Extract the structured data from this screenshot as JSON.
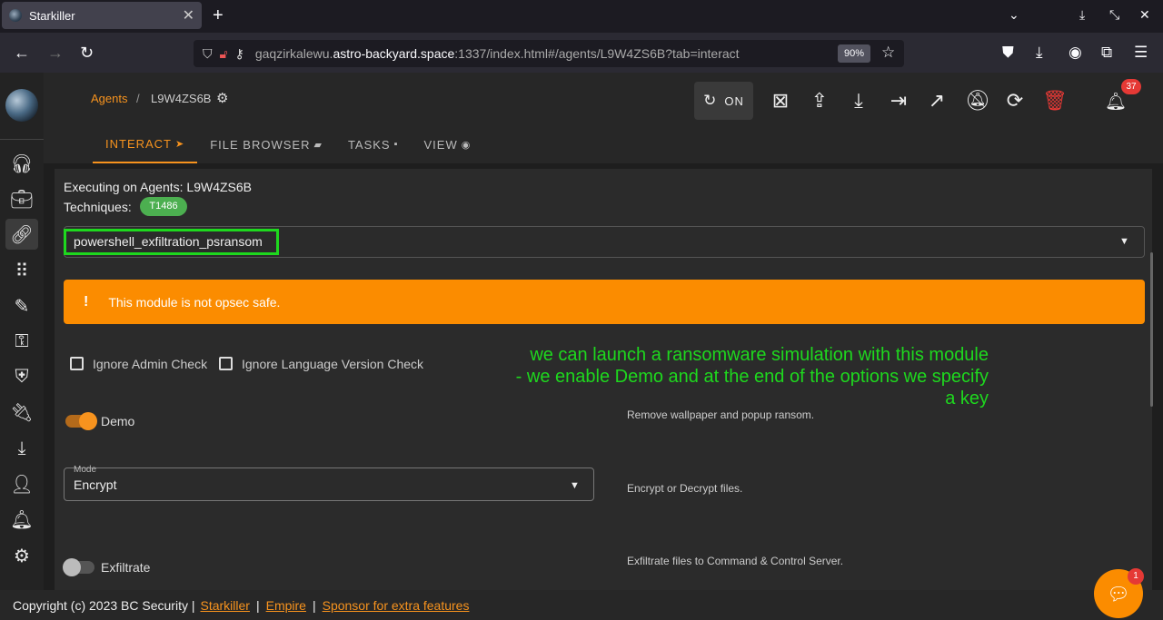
{
  "browser": {
    "tab_title": "Starkiller",
    "tab_close": "✕",
    "new_tab": "+",
    "url_prefix": "gaqzirkalewu.",
    "url_domain": "astro-backyard.space",
    "url_rest": ":1337/index.html#/agents/L9W4ZS6B?tab=interact",
    "zoom": "90%"
  },
  "breadcrumb": {
    "agents": "Agents",
    "separator": "/",
    "current": "L9W4ZS6B"
  },
  "toolbar": {
    "on_label": "ON",
    "notification_count": "37"
  },
  "tabs": [
    {
      "label": "INTERACT",
      "active": true
    },
    {
      "label": "FILE BROWSER",
      "active": false
    },
    {
      "label": "TASKS",
      "active": false
    },
    {
      "label": "VIEW",
      "active": false
    }
  ],
  "interact": {
    "executing": "Executing on Agents: L9W4ZS6B",
    "techniques_label": "Techniques:",
    "technique_chip": "T1486",
    "module": "powershell_exfiltration_psransom",
    "warning_icon": "!",
    "warning": "This module is not opsec safe.",
    "checkbox_admin": "Ignore Admin Check",
    "checkbox_language": "Ignore Language Version Check",
    "annotation_lines": [
      "we can launch a ransomware simulation with this module",
      "- we enable Demo and at the end of the options we specify",
      "a key"
    ],
    "options": {
      "demo_label": "Demo",
      "demo_enabled": true,
      "demo_desc": "Remove wallpaper and popup ransom.",
      "mode_legend": "Mode",
      "mode_value": "Encrypt",
      "mode_desc": "Encrypt or Decrypt files.",
      "exfiltrate_label": "Exfiltrate",
      "exfiltrate_enabled": false,
      "exfiltrate_desc": "Exfiltrate files to Command & Control Server."
    }
  },
  "footer": {
    "copyright": "Copyright (c) 2023 BC Security |",
    "link_starkiller": "Starkiller",
    "link_empire": "Empire",
    "link_sponsor": "Sponsor for extra features",
    "sep": "|"
  },
  "chat": {
    "badge": "1"
  },
  "colors": {
    "accent": "#f7931e",
    "warning": "#fb8c00",
    "chip": "#4caf50",
    "annotation": "#1ed81e",
    "danger": "#e53935"
  }
}
